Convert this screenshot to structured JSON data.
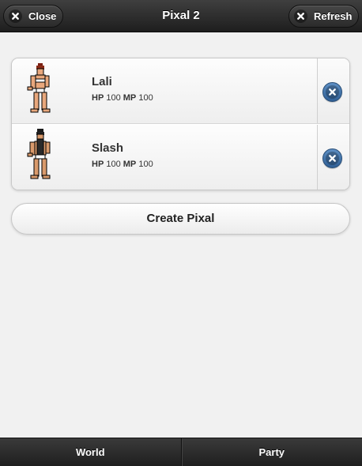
{
  "header": {
    "title": "Pixal 2",
    "close_label": "Close",
    "refresh_label": "Refresh"
  },
  "pixals": [
    {
      "name": "Lali",
      "hp_label": "HP",
      "hp_value": "100",
      "mp_label": "MP",
      "mp_value": "100",
      "sprite": "female-fighter-sprite"
    },
    {
      "name": "Slash",
      "hp_label": "HP",
      "hp_value": "100",
      "mp_label": "MP",
      "mp_value": "100",
      "sprite": "male-fighter-sprite"
    }
  ],
  "create_button_label": "Create Pixal",
  "footer": {
    "items": [
      {
        "label": "World"
      },
      {
        "label": "Party"
      }
    ]
  },
  "colors": {
    "header_bg": "#2a2a2a",
    "delete_button": "#3f70a8",
    "page_bg": "#f1f1f1"
  }
}
